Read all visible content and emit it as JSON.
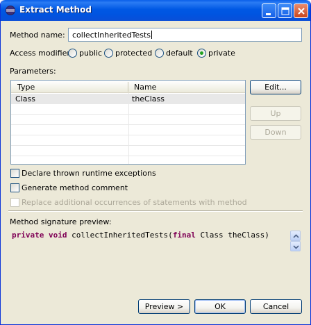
{
  "window": {
    "title": "Extract Method"
  },
  "method_name": {
    "label": "Method name:",
    "value": "collectInheritedTests"
  },
  "access_modifier": {
    "label": "Access modifier:",
    "options": [
      "public",
      "protected",
      "default",
      "private"
    ],
    "selected": "private"
  },
  "parameters": {
    "label": "Parameters:",
    "columns": [
      "Type",
      "Name"
    ],
    "rows": [
      {
        "type": "Class",
        "name": "theClass"
      }
    ]
  },
  "side_buttons": {
    "edit": "Edit...",
    "up": "Up",
    "down": "Down"
  },
  "options": {
    "declare_exceptions": "Declare thrown runtime exceptions",
    "generate_comment": "Generate method comment",
    "replace_occurrences": "Replace additional occurrences of statements with method"
  },
  "preview": {
    "label": "Method signature preview:",
    "kw_private": "private",
    "kw_void": "void",
    "text1": " collectInheritedTests(",
    "kw_final": "final",
    "text2": " Class theClass)"
  },
  "footer": {
    "preview": "Preview >",
    "ok": "OK",
    "cancel": "Cancel"
  },
  "colors": {
    "keyword": "#7f0055",
    "titlebar": "#0054e0",
    "dialog_bg": "#ece9d8"
  }
}
